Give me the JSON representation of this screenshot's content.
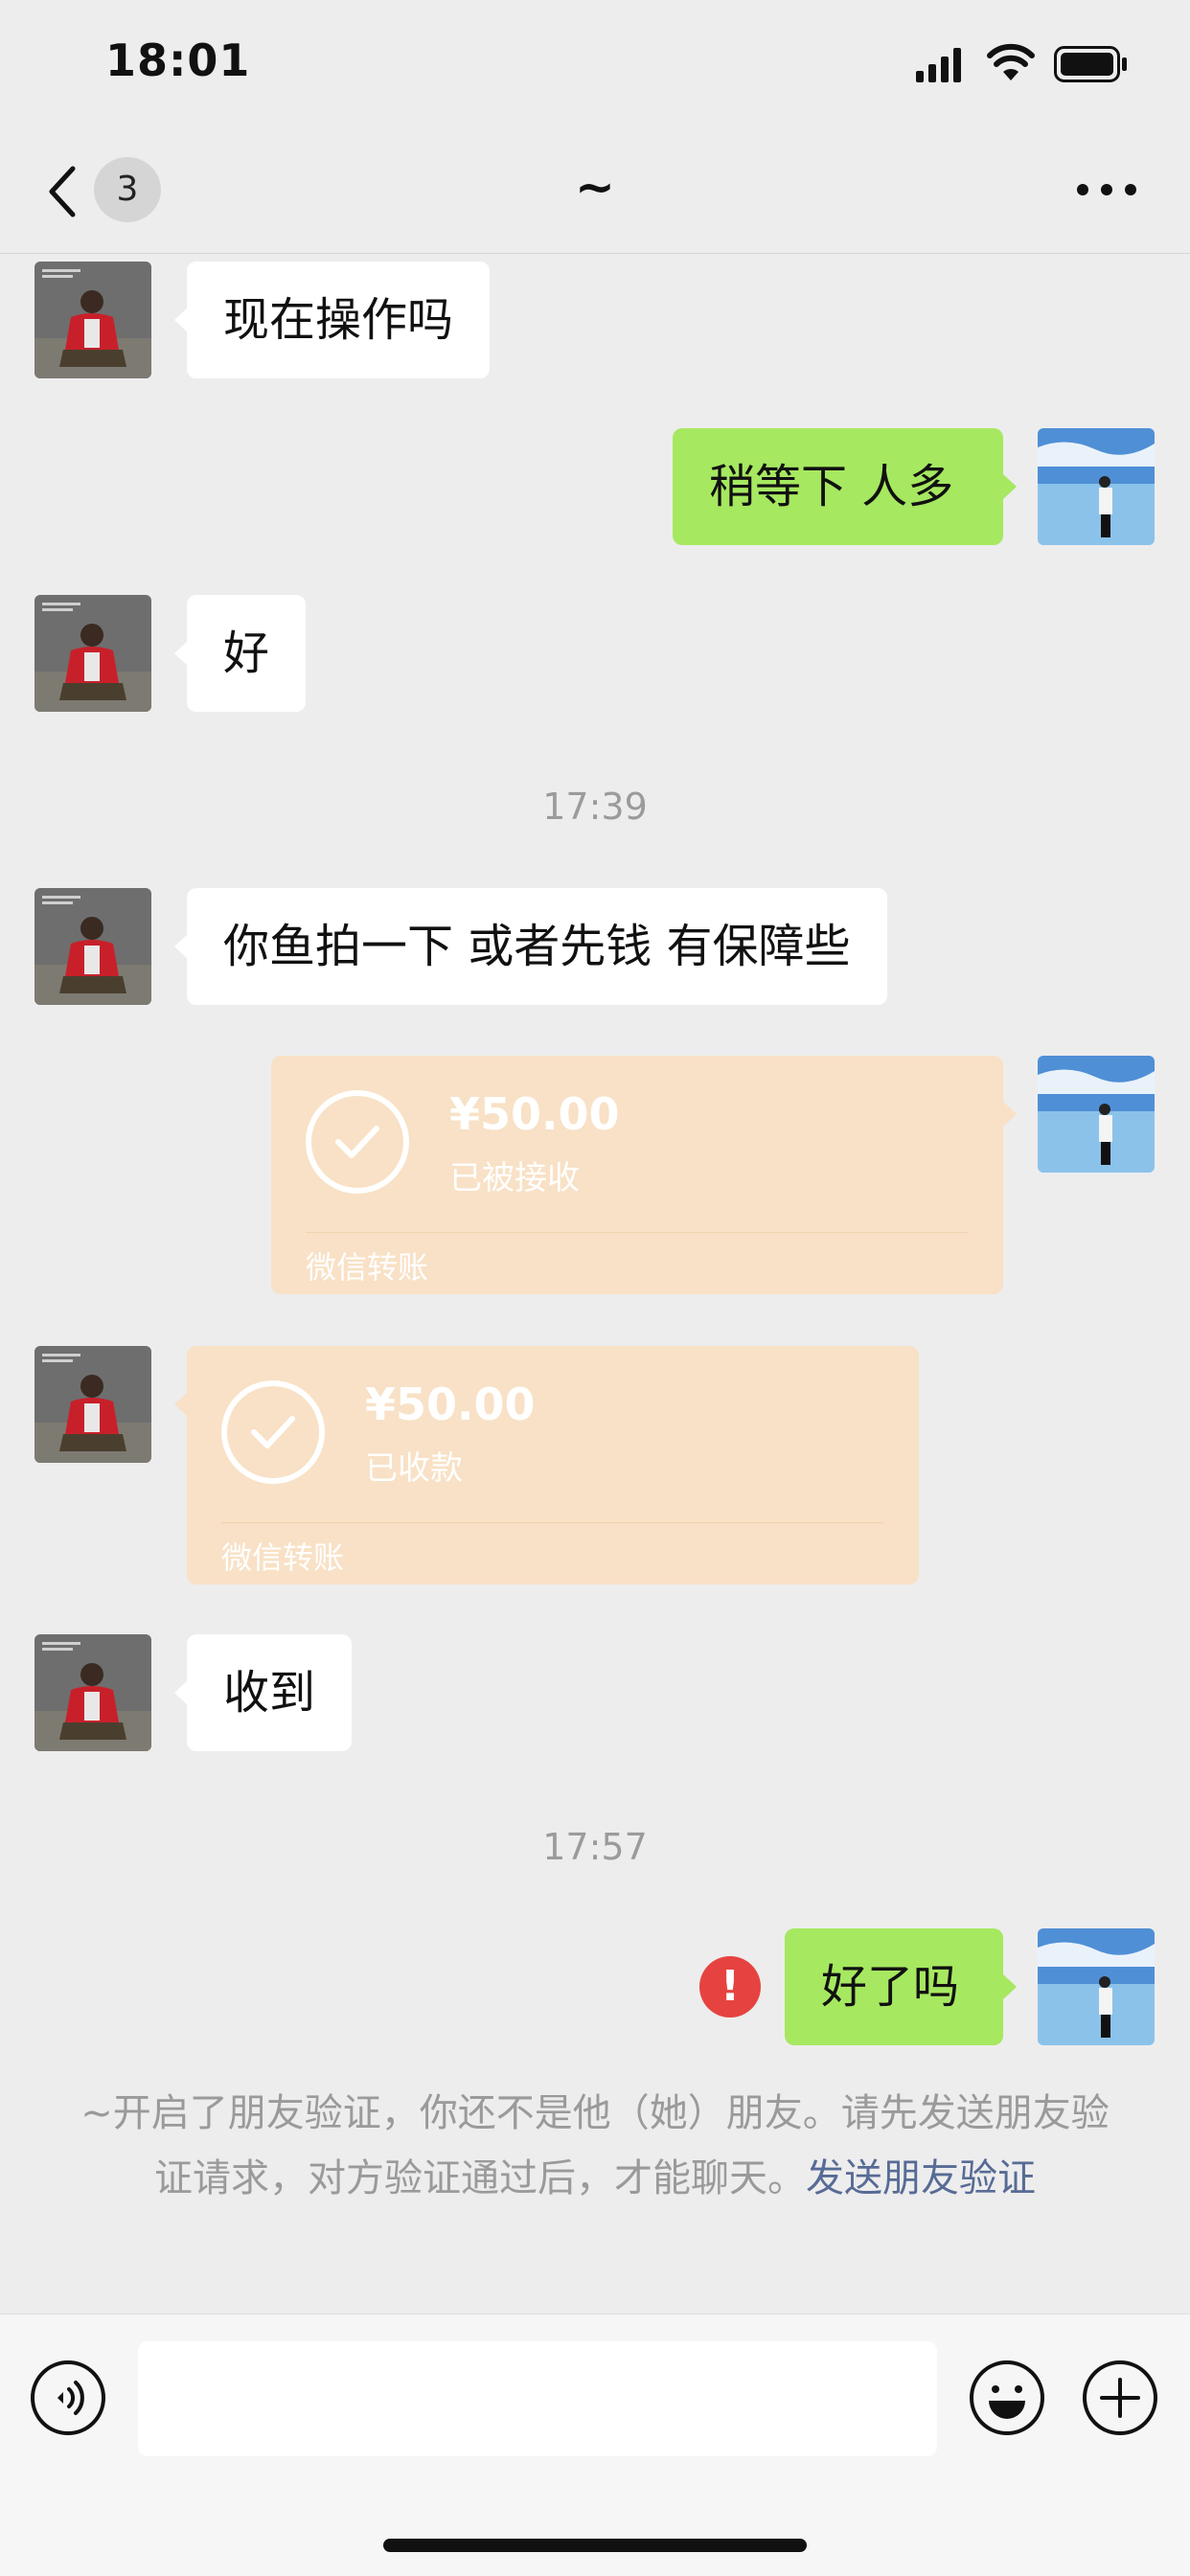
{
  "status_bar": {
    "time": "18:01"
  },
  "nav": {
    "unread_count": "3",
    "title": "~"
  },
  "messages": [
    {
      "text": "现在操作吗"
    },
    {
      "text": "稍等下 人多"
    },
    {
      "text": "好"
    },
    {
      "text": "你鱼拍一下 或者先钱 有保障些"
    },
    {
      "amount": "¥50.00",
      "status": "已被接收",
      "footer": "微信转账"
    },
    {
      "amount": "¥50.00",
      "status": "已收款",
      "footer": "微信转账"
    },
    {
      "text": "收到"
    },
    {
      "text": "好了吗"
    }
  ],
  "timestamps": [
    "17:39",
    "17:57"
  ],
  "error_mark": "!",
  "system_notice": {
    "text": "~开启了朋友验证，你还不是他（她）朋友。请先发送朋友验证请求，对方验证通过后，才能聊天。",
    "link": "发送朋友验证"
  },
  "input": {
    "placeholder": ""
  },
  "colors": {
    "background": "#ededed",
    "outgoing_bubble": "#a6e860",
    "incoming_bubble": "#ffffff",
    "transfer_card": "#f8e1c6",
    "error": "#e64340",
    "link": "#576b95"
  },
  "icons": [
    "signal-icon",
    "wifi-icon",
    "battery-icon",
    "back-chevron-icon",
    "more-icon",
    "check-icon",
    "voice-icon",
    "emoji-icon",
    "plus-icon"
  ]
}
